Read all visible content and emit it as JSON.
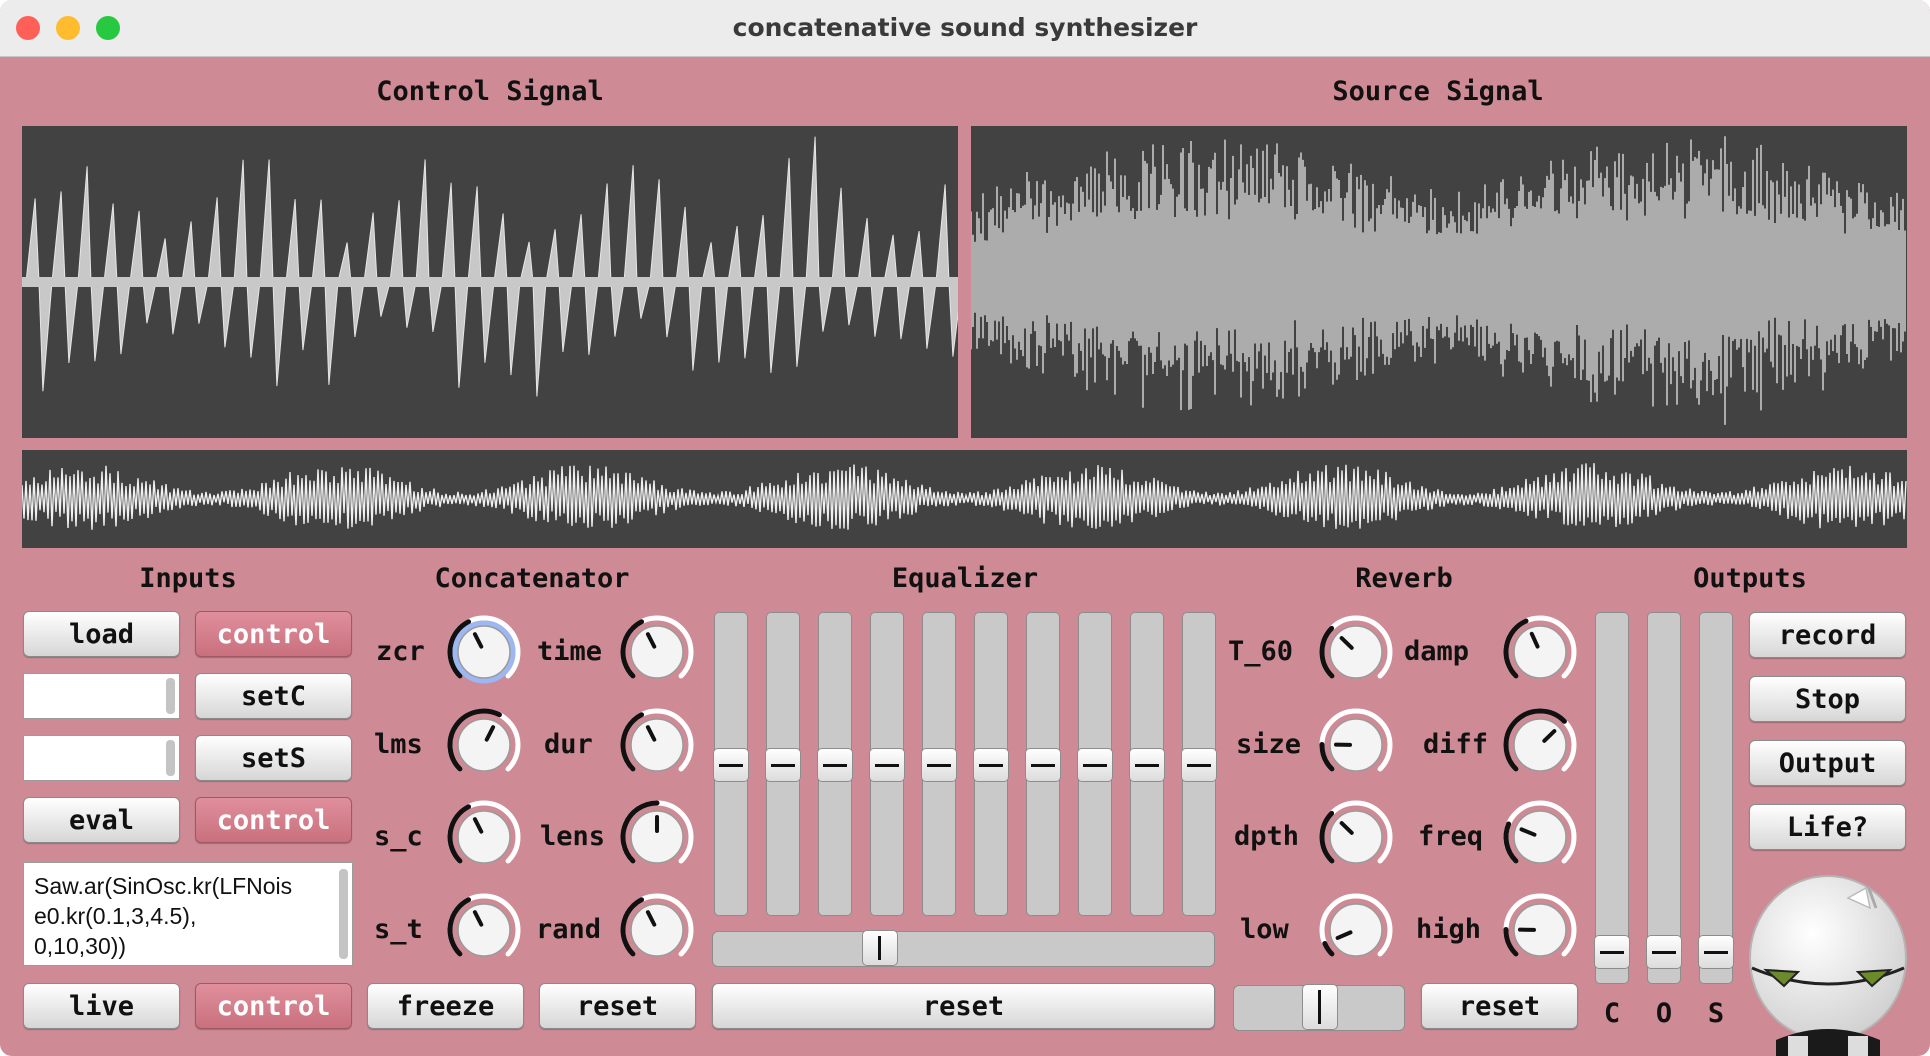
{
  "window": {
    "title": "concatenative sound synthesizer",
    "close_color": "#fe5f57",
    "minimize_color": "#febc2e",
    "zoom_color": "#28c840",
    "background": "#cf8b95"
  },
  "sections": {
    "control_signal": "Control Signal",
    "source_signal": "Source Signal",
    "inputs": "Inputs",
    "concatenator": "Concatenator",
    "equalizer": "Equalizer",
    "reverb": "Reverb",
    "outputs": "Outputs"
  },
  "inputs": {
    "load": "load",
    "control_1": "control",
    "setC": "setC",
    "setS": "setS",
    "eval": "eval",
    "control_2": "control",
    "code": "Saw.ar(SinOsc.kr(LFNois\ne0.kr(0.1,3,4.5),\n0,10,30))",
    "live": "live",
    "control_3": "control"
  },
  "concatenator": {
    "knobs": [
      {
        "label": "zcr",
        "value": 0.4
      },
      {
        "label": "time",
        "value": 0.4
      },
      {
        "label": "lms",
        "value": 0.6
      },
      {
        "label": "dur",
        "value": 0.4
      },
      {
        "label": "s_c",
        "value": 0.4
      },
      {
        "label": "lens",
        "value": 0.5
      },
      {
        "label": "s_t",
        "value": 0.4
      },
      {
        "label": "rand",
        "value": 0.4
      }
    ],
    "freeze": "freeze",
    "reset": "reset"
  },
  "equalizer": {
    "bands": [
      0.5,
      0.5,
      0.5,
      0.5,
      0.5,
      0.5,
      0.5,
      0.5,
      0.5,
      0.5
    ],
    "balance": 0.32,
    "reset": "reset"
  },
  "reverb": {
    "knobs": [
      {
        "label": "T_60",
        "value": 0.33
      },
      {
        "label": "damp",
        "value": 0.41
      },
      {
        "label": "size",
        "value": 0.17
      },
      {
        "label": "diff",
        "value": 0.67
      },
      {
        "label": "dpth",
        "value": 0.33
      },
      {
        "label": "freq",
        "value": 0.25
      },
      {
        "label": "low",
        "value": 0.08
      },
      {
        "label": "high",
        "value": 0.17
      }
    ],
    "mix": 0.5,
    "reset": "reset"
  },
  "outputs": {
    "record": "record",
    "stop": "Stop",
    "output": "Output",
    "life": "Life?",
    "meters": [
      {
        "label": "C",
        "level": 0.04
      },
      {
        "label": "O",
        "level": 0.04
      },
      {
        "label": "S",
        "level": 0.04
      }
    ]
  }
}
